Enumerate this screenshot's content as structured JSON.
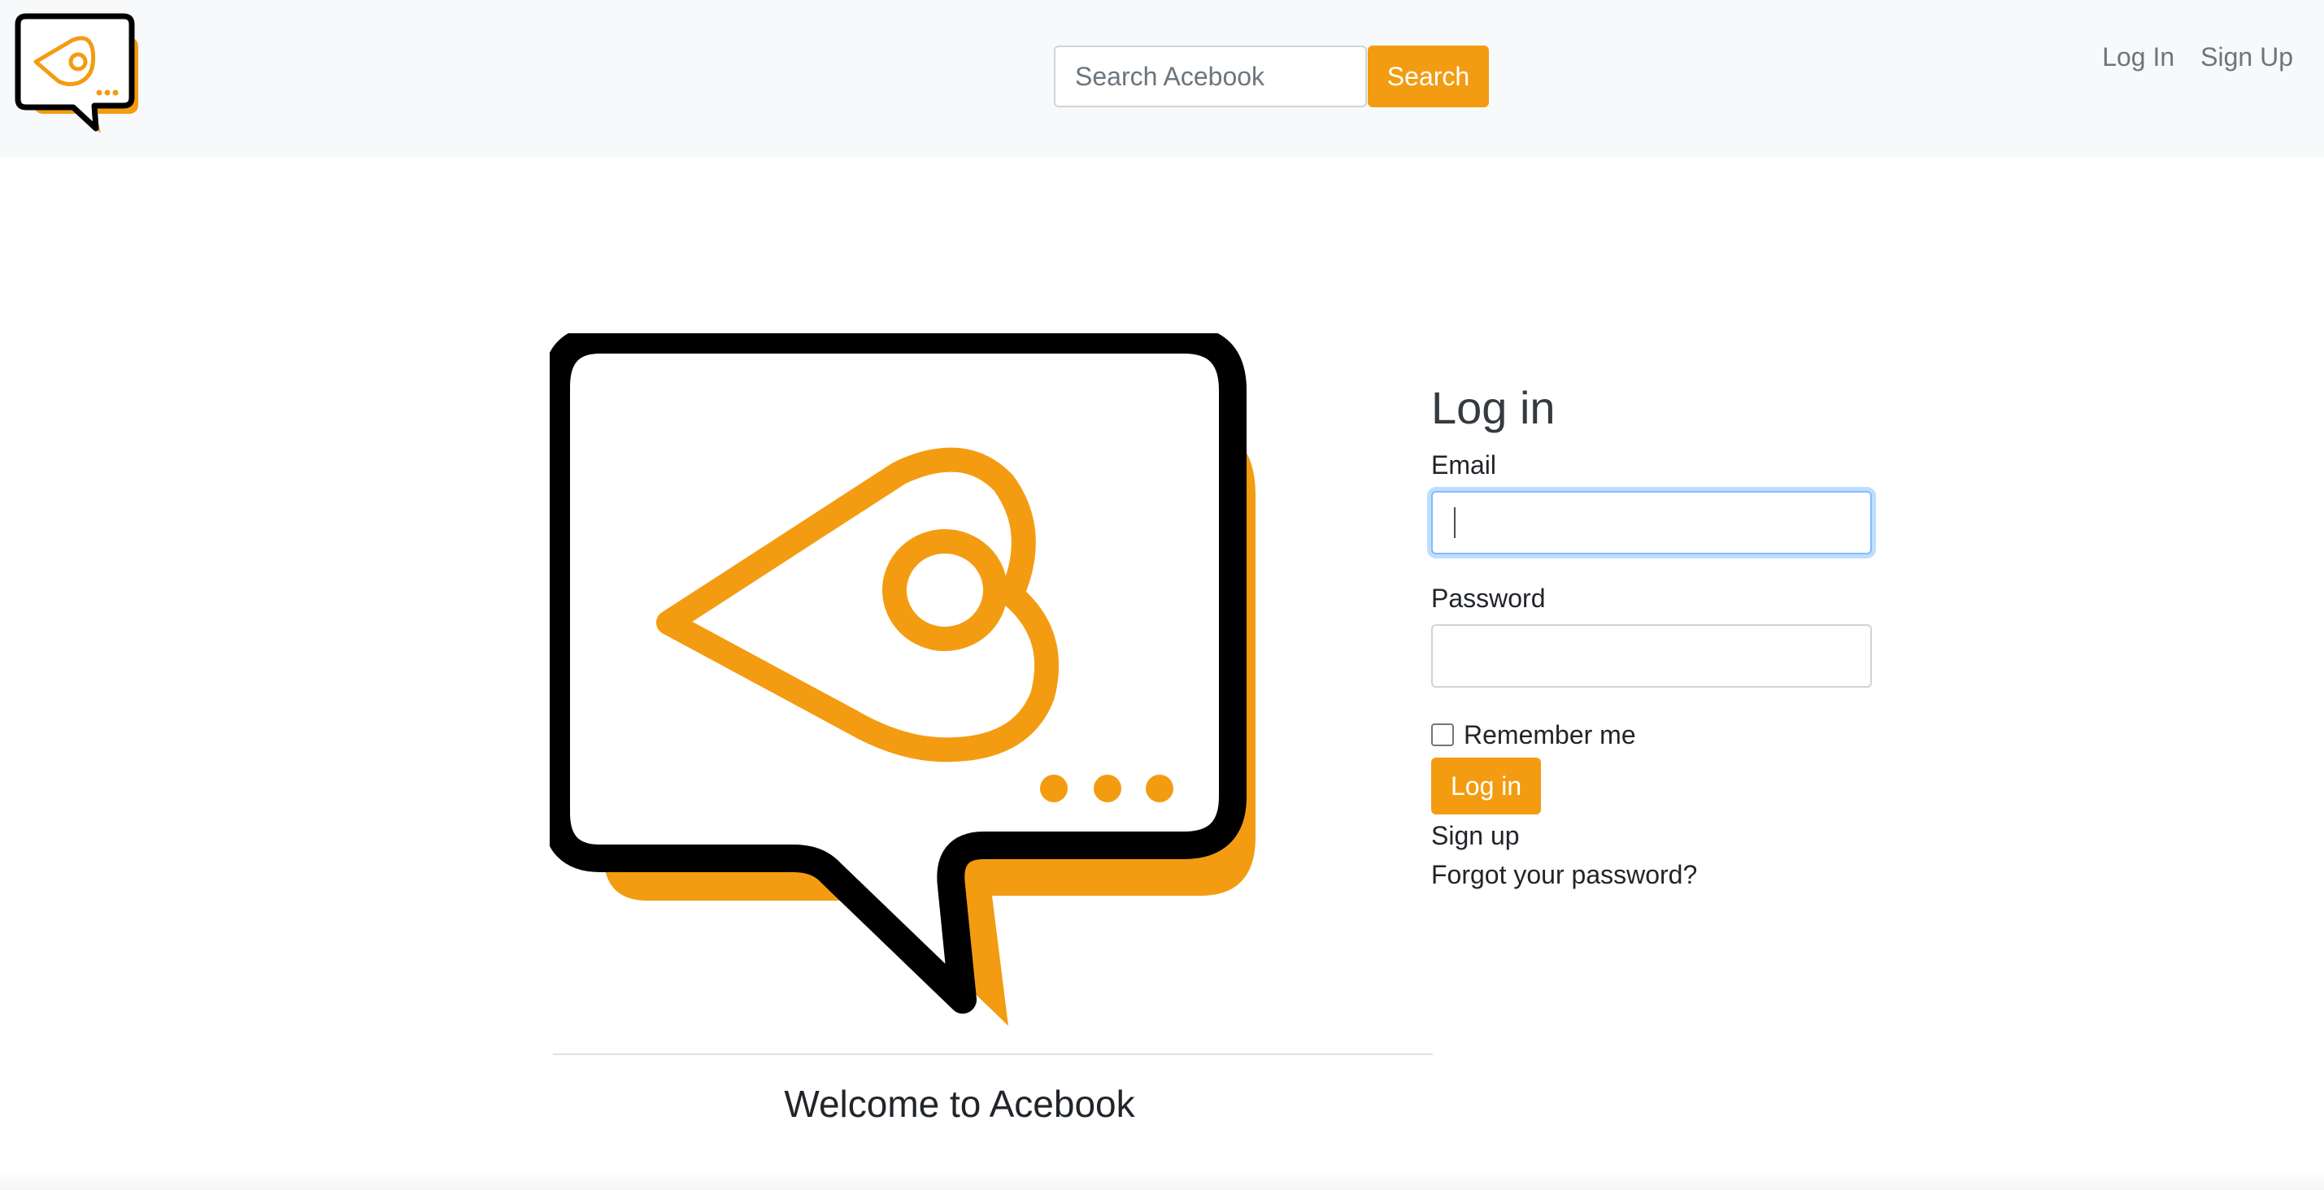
{
  "brand": {
    "name": "Acebook",
    "logo_icon": "speech-bubble-heart-logo",
    "accent_color": "#f39c12",
    "outline_color": "#000000"
  },
  "navbar": {
    "search": {
      "placeholder": "Search Acebook",
      "button_label": "Search"
    },
    "links": [
      {
        "label": "Log In"
      },
      {
        "label": "Sign Up"
      }
    ]
  },
  "hero": {
    "welcome_text": "Welcome to Acebook"
  },
  "login": {
    "heading": "Log in",
    "email_label": "Email",
    "email_value": "",
    "password_label": "Password",
    "password_value": "",
    "remember_label": "Remember me",
    "remember_checked": false,
    "submit_label": "Log in",
    "signup_link": "Sign up",
    "forgot_link": "Forgot your password?"
  }
}
